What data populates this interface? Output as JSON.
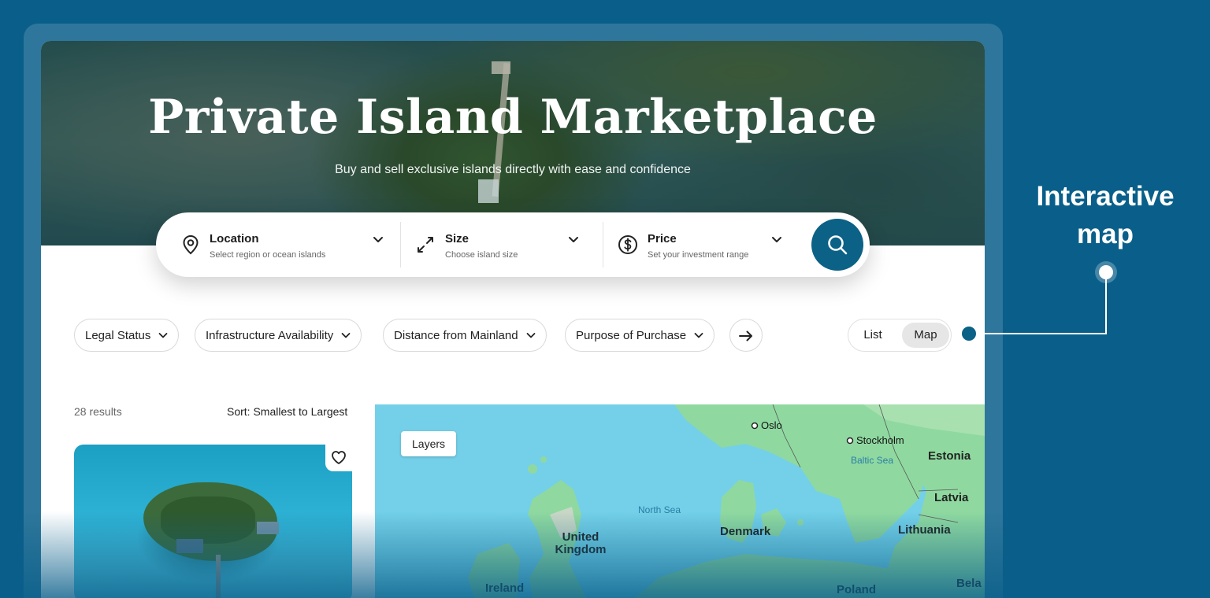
{
  "hero": {
    "title": "Private Island Marketplace",
    "subtitle": "Buy and sell exclusive islands directly with ease and confidence"
  },
  "search": {
    "location": {
      "label": "Location",
      "hint": "Select region or ocean islands",
      "icon": "map-pin-icon"
    },
    "size": {
      "label": "Size",
      "hint": "Choose island size",
      "icon": "expand-arrows-icon"
    },
    "price": {
      "label": "Price",
      "hint": "Set your investment range",
      "icon": "dollar-circle-icon"
    },
    "button_icon": "search-icon"
  },
  "filters": [
    {
      "label": "Legal Status"
    },
    {
      "label": "Infrastructure Availability"
    },
    {
      "label": "Distance from Mainland"
    },
    {
      "label": "Purpose of Purchase"
    }
  ],
  "view_toggle": {
    "list": "List",
    "map": "Map",
    "selected": "Map"
  },
  "results": {
    "count": "28 results",
    "sort": "Sort: Smallest to Largest"
  },
  "map": {
    "layers_button": "Layers",
    "countries": [
      "United Kingdom",
      "Denmark",
      "Lithuania",
      "Latvia",
      "Estonia",
      "Ireland",
      "Poland",
      "Bela"
    ],
    "seas": [
      "North Sea",
      "Baltic Sea"
    ],
    "cities": [
      "Oslo",
      "Stockholm"
    ]
  },
  "annotation": {
    "text": "Interactive map"
  },
  "colors": {
    "brand": "#0b6186",
    "background": "#0a5f8a",
    "water": "#73d0e8",
    "land": "#8fd9a0"
  }
}
